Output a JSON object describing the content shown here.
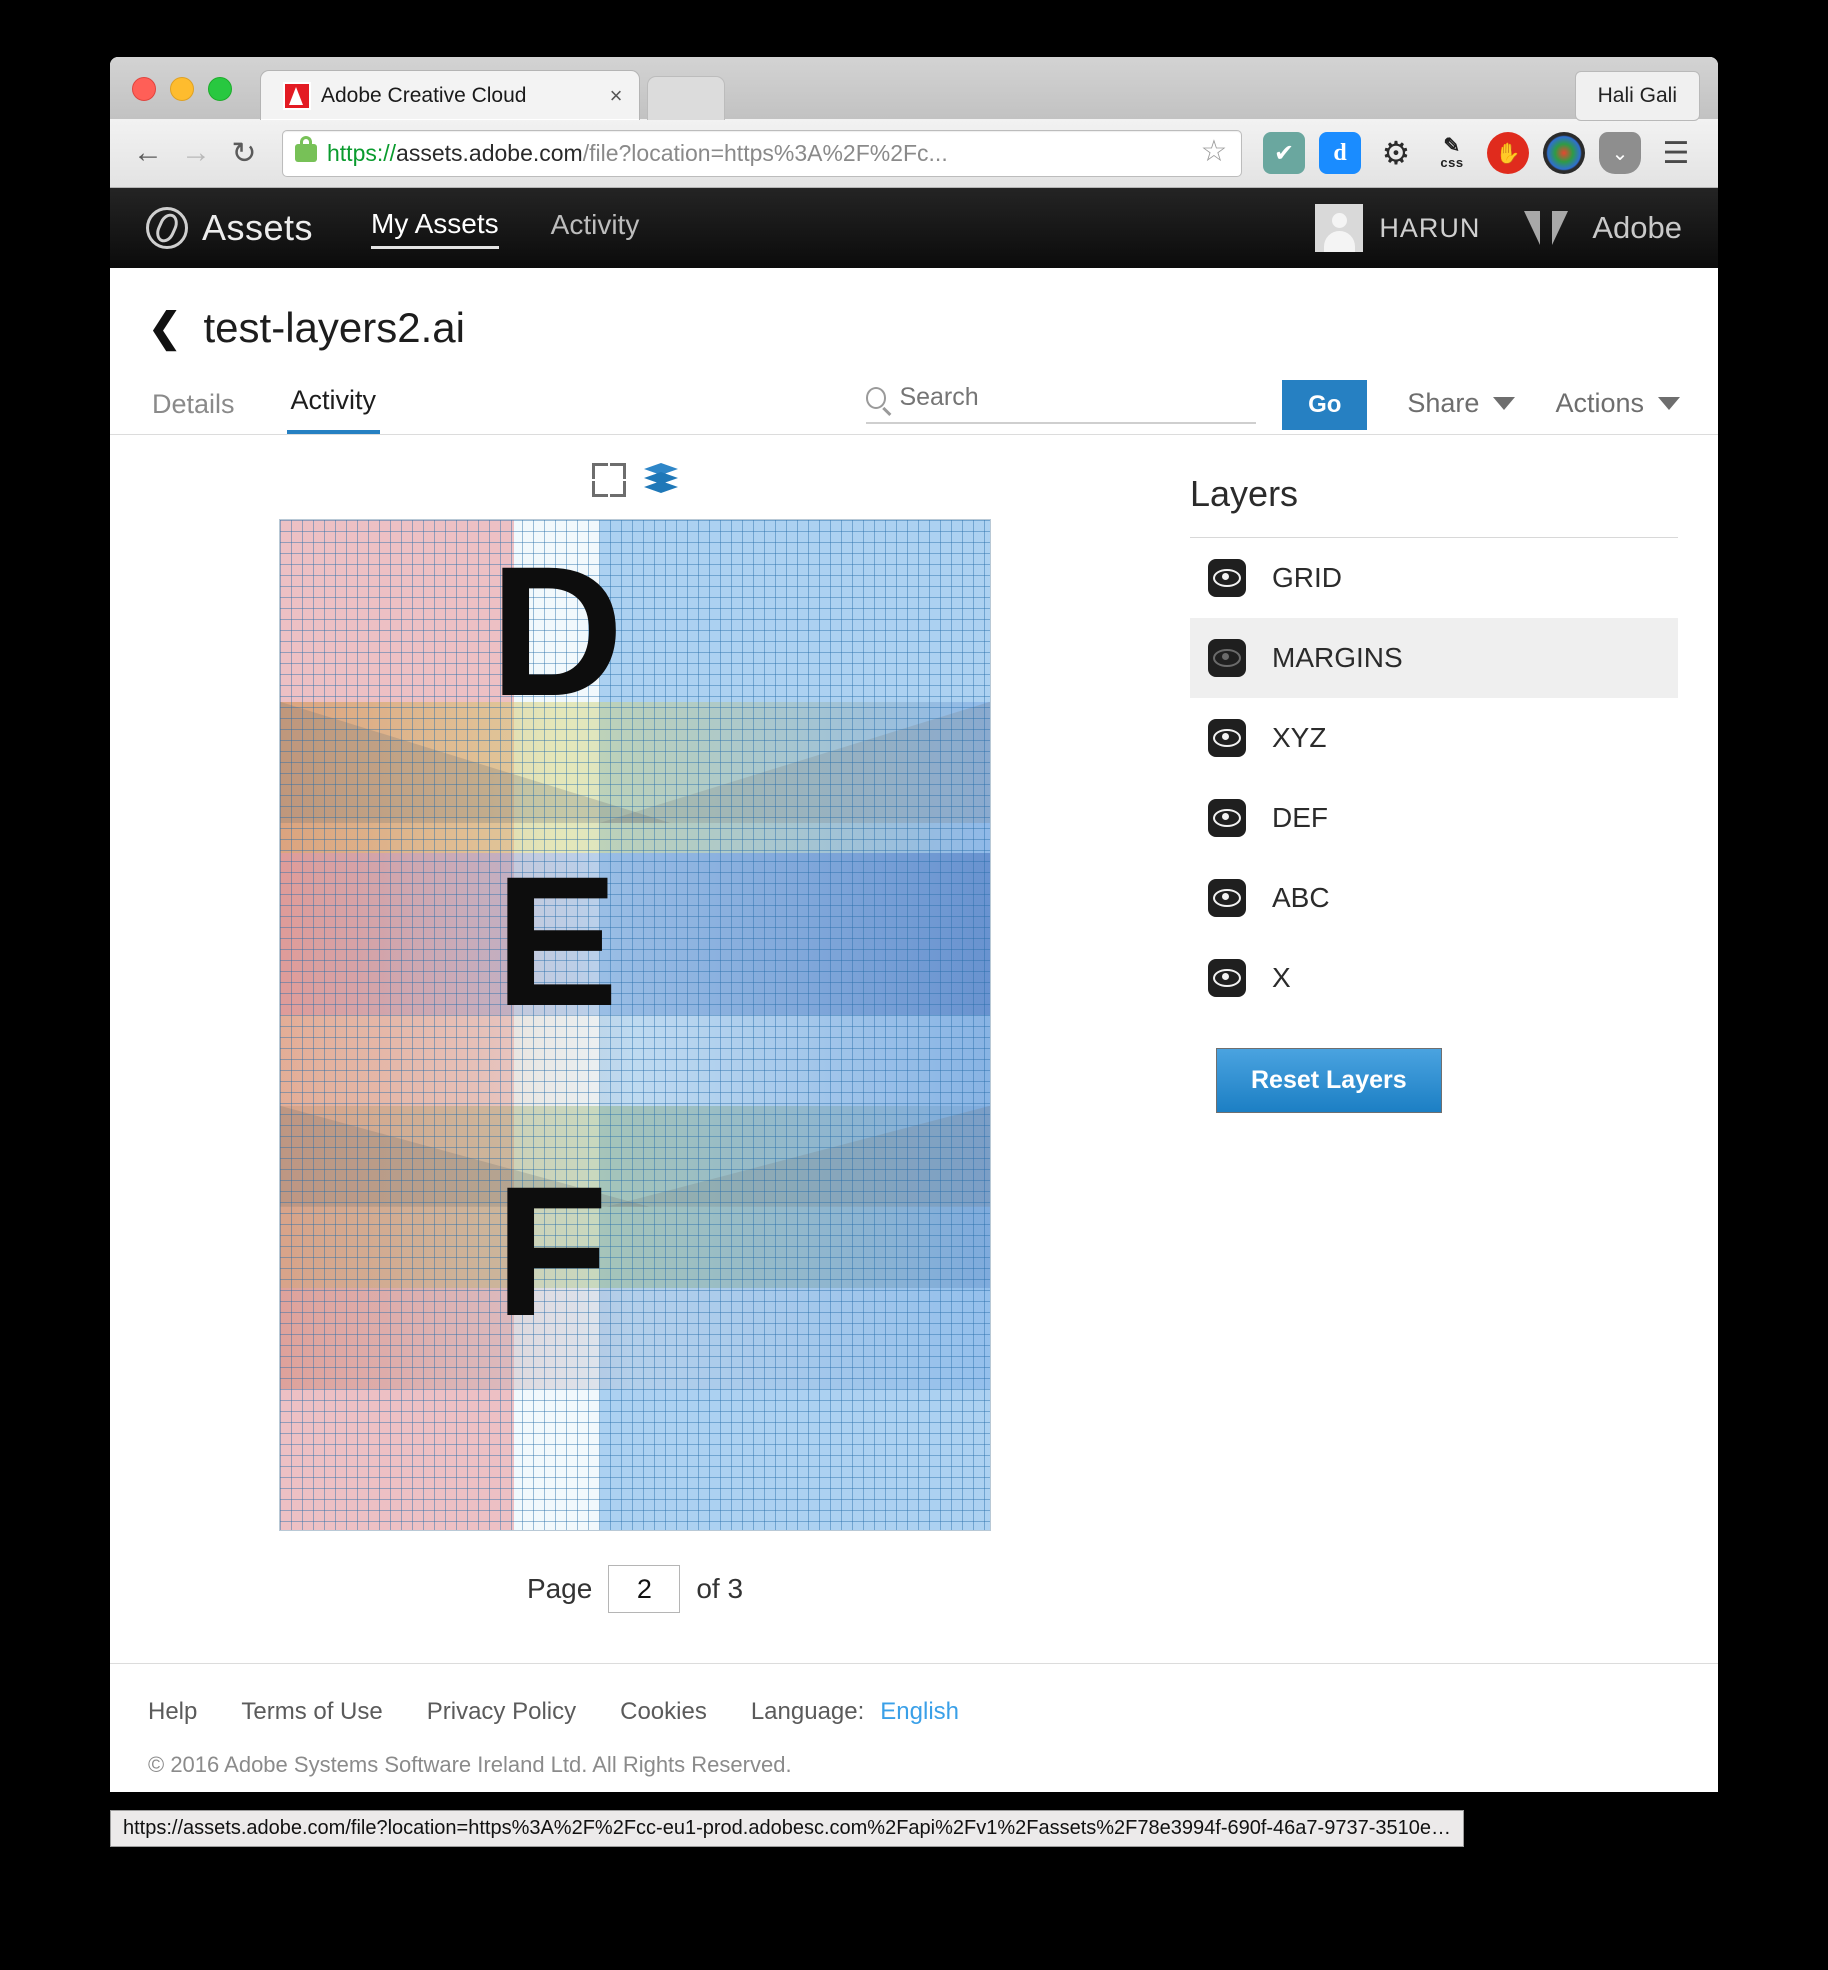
{
  "browser": {
    "tab": {
      "title": "Adobe Creative Cloud",
      "close": "×"
    },
    "profile": "Hali Gali",
    "nav": {
      "back": "←",
      "forward": "→",
      "reload": "↻"
    },
    "url": {
      "scheme": "https://",
      "host": "assets.adobe.com",
      "path": "/file?location=https%3A%2F%2Fc...",
      "full": "https://assets.adobe.com/file?location=https%3A%2F%2Fc..."
    },
    "bookmark_star": "☆",
    "extensions": [
      {
        "name": "todoist-icon",
        "glyph": "✔"
      },
      {
        "name": "douban-icon",
        "glyph": "d"
      },
      {
        "name": "gear-icon",
        "glyph": "⚙"
      },
      {
        "name": "css-editor-icon",
        "glyph": "✎",
        "label": "css"
      },
      {
        "name": "adblock-icon",
        "glyph": "✋"
      },
      {
        "name": "screenshot-camera-icon",
        "glyph": ""
      },
      {
        "name": "pocket-icon",
        "glyph": "⌄"
      },
      {
        "name": "browser-menu-icon",
        "glyph": "☰"
      }
    ],
    "status_url": "https://assets.adobe.com/file?location=https%3A%2F%2Fcc-eu1-prod.adobesc.com%2Fapi%2Fv1%2Fassets%2F78e3994f-690f-46a7-9737-3510e…"
  },
  "appbar": {
    "brand": "Assets",
    "nav": [
      {
        "label": "My Assets",
        "active": true
      },
      {
        "label": "Activity",
        "active": false
      }
    ],
    "user": "HARUN",
    "company": "Adobe"
  },
  "asset": {
    "back": "❮",
    "title": "test-layers2.ai",
    "tabs": [
      {
        "label": "Details",
        "active": false
      },
      {
        "label": "Activity",
        "active": true
      }
    ],
    "search_placeholder": "Search",
    "search_value": "",
    "go_label": "Go",
    "share_label": "Share",
    "actions_label": "Actions"
  },
  "viewer": {
    "expand_icon": "fullscreen-icon",
    "layers_icon": "layers-icon",
    "page_label": "Page",
    "page_value": "2",
    "page_of": "of 3"
  },
  "layers_panel": {
    "heading": "Layers",
    "items": [
      {
        "name": "GRID",
        "visible": true,
        "selected": false
      },
      {
        "name": "MARGINS",
        "visible": false,
        "selected": true
      },
      {
        "name": "XYZ",
        "visible": true,
        "selected": false
      },
      {
        "name": "DEF",
        "visible": true,
        "selected": false
      },
      {
        "name": "ABC",
        "visible": true,
        "selected": false
      },
      {
        "name": "X",
        "visible": true,
        "selected": false
      }
    ],
    "reset_label": "Reset Layers"
  },
  "artboard": {
    "letters": [
      "D",
      "E",
      "F"
    ]
  },
  "footer": {
    "links": [
      "Help",
      "Terms of Use",
      "Privacy Policy",
      "Cookies"
    ],
    "language_label": "Language:",
    "language_value": "English",
    "copyright": "© 2016 Adobe Systems Software Ireland Ltd. All Rights Reserved."
  },
  "colors": {
    "accent_blue": "#2680c2",
    "link_blue": "#3aa0e8",
    "appbar_black": "#111111"
  }
}
